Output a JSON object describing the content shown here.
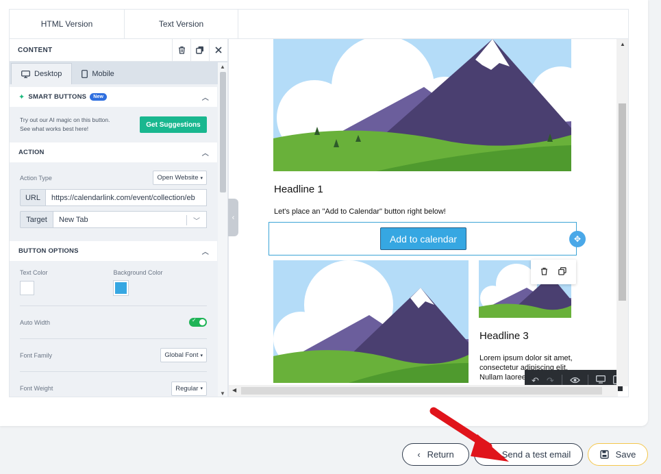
{
  "tabs": [
    {
      "label": "HTML Version"
    },
    {
      "label": "Text Version"
    }
  ],
  "panel": {
    "title": "CONTENT",
    "icons": {
      "delete": "trash-icon",
      "duplicate": "copy-icon",
      "close": "close-icon"
    }
  },
  "devices": {
    "desktop": "Desktop",
    "mobile": "Mobile"
  },
  "smart_buttons": {
    "title": "SMART BUTTONS",
    "badge": "New",
    "text_line1": "Try out our AI magic on this button.",
    "text_line2": "See what works best here!",
    "button": "Get Suggestions"
  },
  "action": {
    "title": "ACTION",
    "action_type_label": "Action Type",
    "action_type_value": "Open Website",
    "url_label": "URL",
    "url_value": "https://calendarlink.com/event/collection/eb",
    "target_label": "Target",
    "target_value": "New Tab"
  },
  "button_options": {
    "title": "BUTTON OPTIONS",
    "text_color_label": "Text Color",
    "text_color": "#ffffff",
    "bg_color_label": "Background Color",
    "bg_color": "#36a7e2",
    "auto_width_label": "Auto Width",
    "auto_width": true,
    "font_family_label": "Font Family",
    "font_family_value": "Global Font",
    "font_weight_label": "Font Weight",
    "font_weight_value": "Regular"
  },
  "preview": {
    "headline1": "Headline 1",
    "paragraph1": "Let's place an \"Add to Calendar\" button right below!",
    "button_label": "Add to calendar",
    "headline3": "Headline 3",
    "lorem_line1": "Lorem ipsum dolor sit amet,",
    "lorem_line2": "consectetur adipiscing elit.",
    "lorem_line3": "Nullam laoreet"
  },
  "footer": {
    "return": "Return",
    "send_test": "Send a test email",
    "save": "Save"
  },
  "colors": {
    "accent_green": "#19b78f",
    "button_blue": "#36a7e2",
    "save_border": "#f4c64a",
    "annotation_arrow": "#e0141b"
  }
}
